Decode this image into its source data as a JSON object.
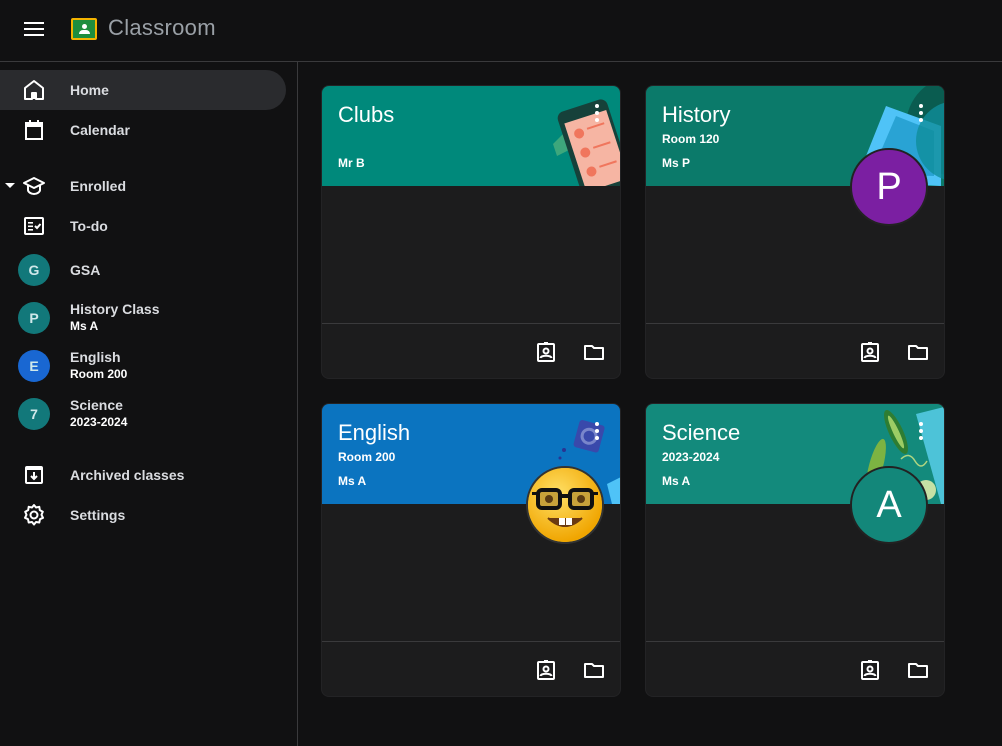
{
  "app": {
    "title": "Classroom"
  },
  "sidebar": {
    "home": "Home",
    "calendar": "Calendar",
    "enrolled": "Enrolled",
    "todo": "To-do",
    "classes": [
      {
        "initial": "G",
        "name": "GSA",
        "subtitle": "",
        "color": "#12787a"
      },
      {
        "initial": "P",
        "name": "History Class",
        "subtitle": "Ms A",
        "color": "#12787a"
      },
      {
        "initial": "E",
        "name": "English",
        "subtitle": "Room 200",
        "color": "#1967d2"
      },
      {
        "initial": "7",
        "name": "Science",
        "subtitle": "2023-2024",
        "color": "#12787a"
      }
    ],
    "archived": "Archived classes",
    "settings": "Settings"
  },
  "cards": [
    {
      "title": "Clubs",
      "section": "",
      "teacher": "Mr B",
      "header_color": "#00897b",
      "avatar": "",
      "avatar_color": "",
      "illustration": "phone-contacts"
    },
    {
      "title": "History",
      "section": "Room 120",
      "teacher": "Ms P",
      "header_color": "#0b7a6a",
      "avatar": "P",
      "avatar_color": "#7b1fa2",
      "illustration": "map"
    },
    {
      "title": "English",
      "section": "Room 200",
      "teacher": "Ms A",
      "header_color": "#0b74c0",
      "avatar": "🤓",
      "avatar_color": "transparent",
      "illustration": "cube"
    },
    {
      "title": "Science",
      "section": "2023-2024",
      "teacher": "Ms A",
      "header_color": "#138a7c",
      "avatar": "A",
      "avatar_color": "#13877a",
      "illustration": "peas"
    }
  ],
  "card_actions": {
    "work": "Open your work",
    "folder": "Open folder"
  }
}
